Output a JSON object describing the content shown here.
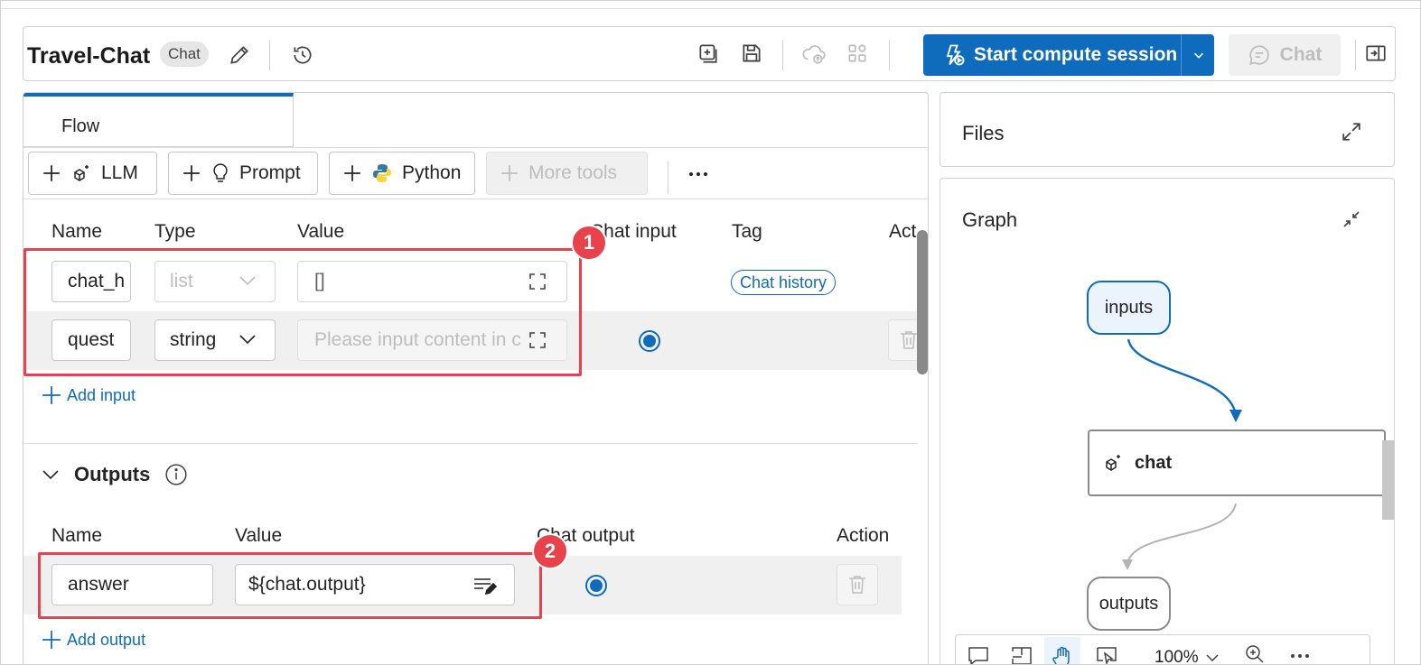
{
  "header": {
    "title": "Travel-Chat",
    "badge": "Chat",
    "start_compute_label": "Start compute session",
    "chat_label": "Chat"
  },
  "tabs": {
    "flow": "Flow"
  },
  "toolbar": {
    "llm": "LLM",
    "prompt": "Prompt",
    "python": "Python",
    "more_tools": "More tools"
  },
  "inputs": {
    "columns": [
      "Name",
      "Type",
      "Value",
      "Chat input",
      "Tag",
      "Act"
    ],
    "rows": [
      {
        "name": "chat_h",
        "type": "list",
        "value": "[]",
        "tag": "Chat history"
      },
      {
        "name": "quest",
        "type": "string",
        "value_placeholder": "Please input content in c"
      }
    ],
    "add_label": "Add input"
  },
  "outputs": {
    "section_title": "Outputs",
    "columns": [
      "Name",
      "Value",
      "Chat output",
      "Action"
    ],
    "rows": [
      {
        "name": "answer",
        "value": "${chat.output}"
      }
    ],
    "add_label": "Add output"
  },
  "callouts": [
    "1",
    "2"
  ],
  "files": {
    "title": "Files"
  },
  "graph": {
    "title": "Graph",
    "nodes": {
      "inputs": "inputs",
      "chat": "chat",
      "outputs": "outputs"
    },
    "zoom": "100%"
  },
  "colors": {
    "accent": "#0f6cbd",
    "highlight": "#e8434d"
  }
}
